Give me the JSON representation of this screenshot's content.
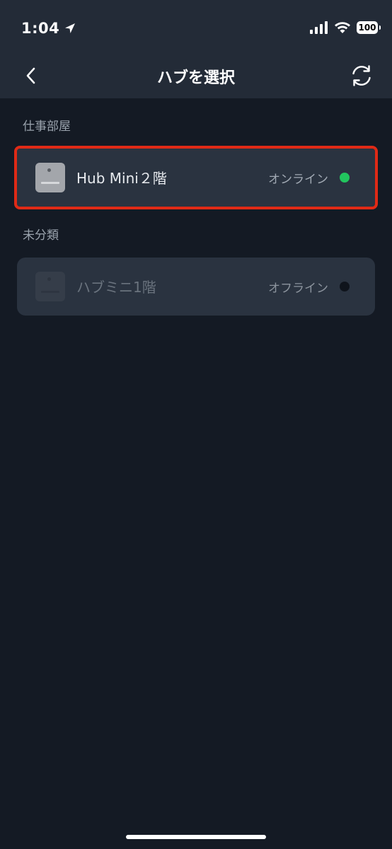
{
  "status_bar": {
    "time": "1:04",
    "battery": "100",
    "icons": [
      "location-arrow-icon",
      "cellular-signal-icon",
      "wifi-icon",
      "battery-icon"
    ]
  },
  "nav": {
    "title": "ハブを選択",
    "back_icon": "chevron-left-icon",
    "refresh_icon": "refresh-icon"
  },
  "sections": [
    {
      "label": "仕事部屋",
      "hubs": [
        {
          "name": "Hub Mini２階",
          "status": "オンライン",
          "status_color": "#22c55e",
          "selected": true
        }
      ]
    },
    {
      "label": "未分類",
      "hubs": [
        {
          "name": "ハブミニ1階",
          "status": "オフライン",
          "status_color": "#0f141c",
          "selected": false
        }
      ]
    }
  ],
  "colors": {
    "background": "#141a24",
    "header": "#232b37",
    "card": "#2a3340",
    "selection_outline": "#e02a16",
    "online_dot": "#22c55e",
    "offline_dot": "#0f141c"
  }
}
